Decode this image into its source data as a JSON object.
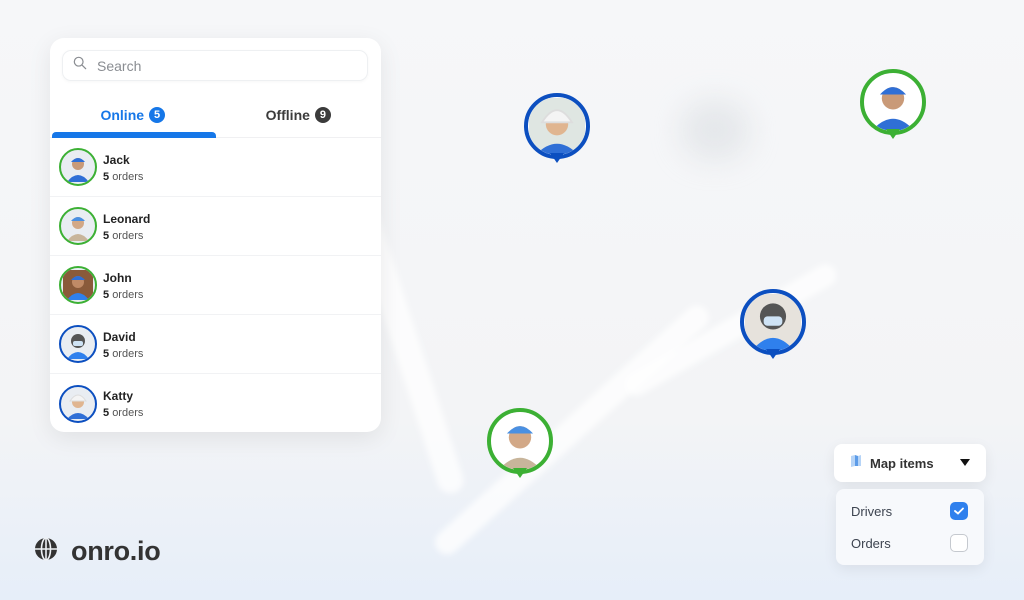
{
  "search": {
    "placeholder": "Search",
    "value": ""
  },
  "tabs": [
    {
      "label": "Online",
      "count": "5",
      "active": true
    },
    {
      "label": "Offline",
      "count": "9",
      "active": false
    }
  ],
  "drivers": [
    {
      "name": "Jack",
      "orders_count": "5",
      "orders_label": "orders",
      "status_color": "green"
    },
    {
      "name": "Leonard",
      "orders_count": "5",
      "orders_label": "orders",
      "status_color": "green"
    },
    {
      "name": "John",
      "orders_count": "5",
      "orders_label": "orders",
      "status_color": "green"
    },
    {
      "name": "David",
      "orders_count": "5",
      "orders_label": "orders",
      "status_color": "blue"
    },
    {
      "name": "Katty",
      "orders_count": "5",
      "orders_label": "orders",
      "status_color": "blue"
    }
  ],
  "map_pins": [
    {
      "driver": "Katty",
      "status_color": "blue"
    },
    {
      "driver": "Jack",
      "status_color": "green"
    },
    {
      "driver": "David",
      "status_color": "blue"
    },
    {
      "driver": "Leonard",
      "status_color": "green"
    }
  ],
  "map_items": {
    "label": "Map items",
    "icon": "map-icon",
    "options": [
      {
        "label": "Drivers",
        "checked": true
      },
      {
        "label": "Orders",
        "checked": false
      }
    ]
  },
  "brand": {
    "icon": "globe-icon",
    "text": "onro.io"
  },
  "colors": {
    "accent": "#1677e8",
    "online_ring": "#3cb034",
    "busy_ring": "#0c4fc0",
    "checkbox": "#2f80ed"
  }
}
